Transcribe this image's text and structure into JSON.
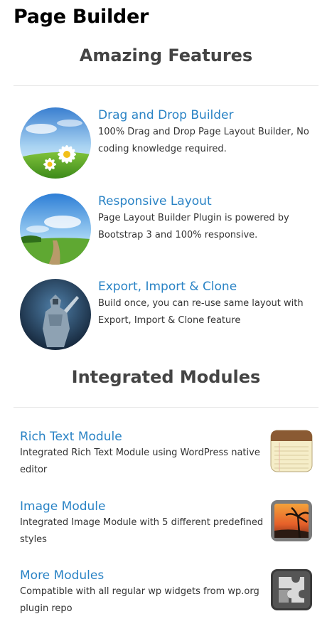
{
  "page": {
    "title": "Page Builder"
  },
  "features": {
    "heading": "Amazing Features",
    "items": [
      {
        "title": "Drag and Drop Builder",
        "desc": "100% Drag and Drop Page Layout Builder, No coding knowledge required.",
        "image": "daisy-field-image"
      },
      {
        "title": "Responsive Layout",
        "desc": "Page Layout Builder Plugin is powered by Bootstrap 3 and 100% responsive.",
        "image": "meadow-path-image"
      },
      {
        "title": "Export, Import & Clone",
        "desc": "Build once, you can re-use same layout with Export, Import & Clone feature",
        "image": "armored-knight-image"
      }
    ]
  },
  "modules": {
    "heading": "Integrated Modules",
    "items": [
      {
        "title": "Rich Text Module",
        "desc": "Integrated Rich Text Module using WordPress native editor",
        "icon": "notepad-icon"
      },
      {
        "title": "Image Module",
        "desc": "Integrated Image Module with 5 different predefined styles",
        "icon": "photo-icon"
      },
      {
        "title": "More Modules",
        "desc": "Compatible with all regular wp widgets from wp.org plugin repo",
        "icon": "puzzle-icon"
      }
    ]
  },
  "colors": {
    "link": "#2a83c5",
    "heading": "#444444",
    "text": "#333333",
    "divider": "#e6e6e6"
  }
}
